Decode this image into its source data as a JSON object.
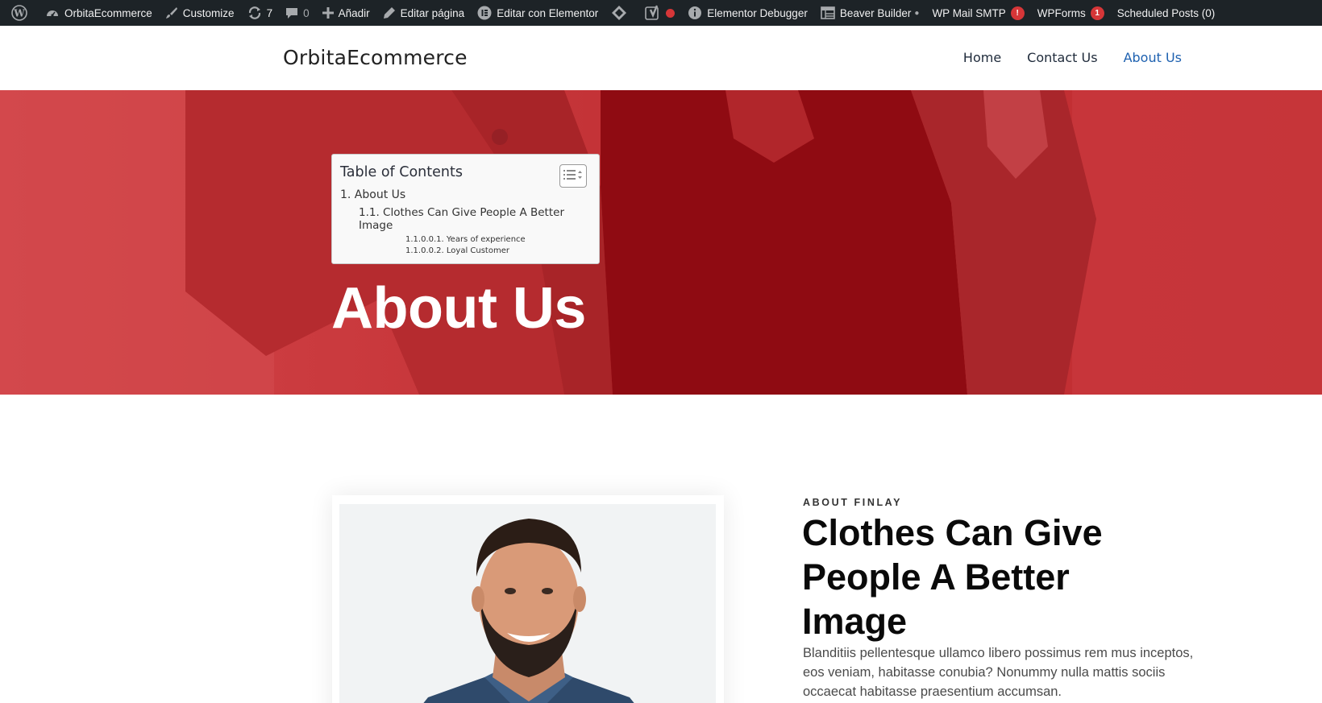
{
  "adminbar": {
    "site": "OrbitaEcommerce",
    "customize": "Customize",
    "updates_count": "7",
    "comments_count": "0",
    "add_new": "Añadir",
    "edit_page": "Editar página",
    "edit_elementor": "Editar con Elementor",
    "elementor_debugger": "Elementor Debugger",
    "beaver_builder": "Beaver Builder",
    "wp_mail_smtp": "WP Mail SMTP",
    "wp_mail_smtp_badge": "!",
    "wpforms": "WPForms",
    "wpforms_badge": "1",
    "scheduled_posts": "Scheduled Posts (0)"
  },
  "header": {
    "site_title": "OrbitaEcommerce",
    "nav": [
      "Home",
      "Contact Us",
      "About Us"
    ],
    "active_nav": "About Us",
    "accent_color": "#1e61b0"
  },
  "hero": {
    "overlay_color": "#c53034",
    "title": "About Us",
    "toc": {
      "title": "Table of Contents",
      "items": [
        "1. About Us",
        "1.1. Clothes Can Give People A Better Image",
        "1.1.0.0.1. Years of experience",
        "1.1.0.0.2. Loyal Customer"
      ]
    }
  },
  "about": {
    "eyebrow": "ABOUT FINLAY",
    "title": "Clothes Can Give People A Better Image",
    "text": "Blanditiis pellentesque ullamco libero possimus rem mus inceptos, eos veniam, habitasse conubia? Nonummy nulla mattis sociis occaecat habitasse praesentium accumsan."
  }
}
